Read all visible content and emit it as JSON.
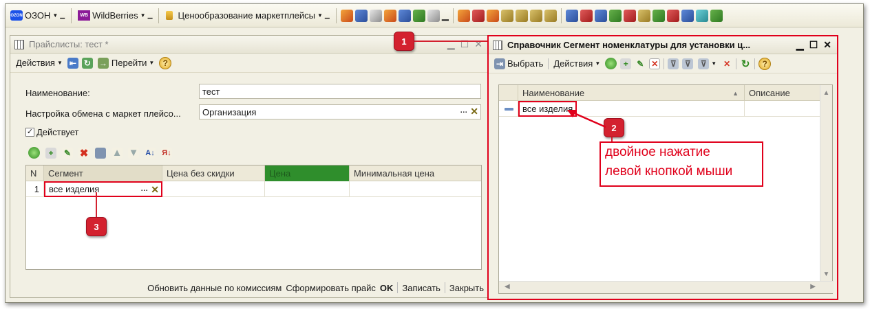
{
  "toolbar": {
    "ozon_label": "ОЗОН",
    "wb_logo_text": "WB",
    "wb_label": "WildBerries",
    "pricing_label": "Ценообразование маркетплейсы",
    "ozon_logo_text": "OZON"
  },
  "left_window": {
    "title": "Прайслисты: тест *",
    "actions_label": "Действия",
    "goto_label": "Перейти",
    "name_label": "Наименование:",
    "name_value": "тест",
    "exchange_label": "Настройка обмена с маркет плейсо...",
    "exchange_value": "Организация",
    "active_label": "Действует",
    "active_checked": true,
    "columns": [
      "N",
      "Сегмент",
      "Цена без скидки",
      "Цена",
      "Минимальная цена"
    ],
    "rows": [
      {
        "n": "1",
        "segment": "все изделия",
        "price_no_discount": "",
        "price": "",
        "min_price": ""
      }
    ],
    "bottom": {
      "update_commissions": "Обновить данные по комиссиям",
      "make_price": "Сформировать прайс",
      "ok": "OK",
      "save": "Записать",
      "close": "Закрыть"
    }
  },
  "right_window": {
    "title": "Справочник Сегмент номенклатуры для установки ц...",
    "select_label": "Выбрать",
    "actions_label": "Действия",
    "columns": [
      "Наименование",
      "Описание"
    ],
    "rows": [
      {
        "name": "все изделия",
        "description": ""
      }
    ]
  },
  "annotations": {
    "marker_1": "1",
    "marker_2": "2",
    "marker_3": "3",
    "callout_line1": "двойное нажатие",
    "callout_line2": "левой кнопкой мыши"
  },
  "colors": {
    "accent_red": "#e0001b",
    "price_column_green": "#2f8e2c",
    "window_bg": "#f2f0e4"
  }
}
